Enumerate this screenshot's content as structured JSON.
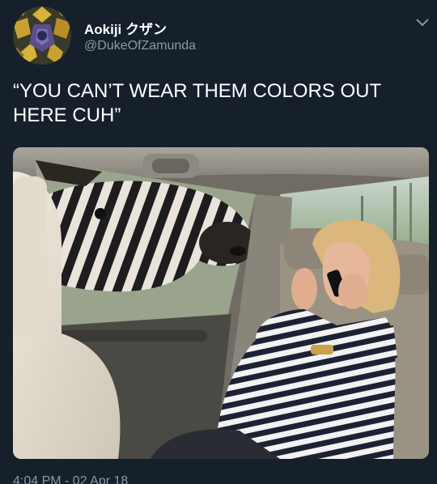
{
  "tweet": {
    "display_name": "Aokiji クザン",
    "handle": "@DukeOfZamunda",
    "text": "“YOU CAN’T WEAR THEM COLORS OUT HERE CUH”",
    "timestamp": "4:04 PM - 02 Apr 18"
  },
  "icons": {
    "avatar": "avatar-image",
    "menu": "chevron-down-icon"
  },
  "colors": {
    "background": "#15202b",
    "primary_text": "#ffffff",
    "secondary_text": "#8899a6"
  }
}
